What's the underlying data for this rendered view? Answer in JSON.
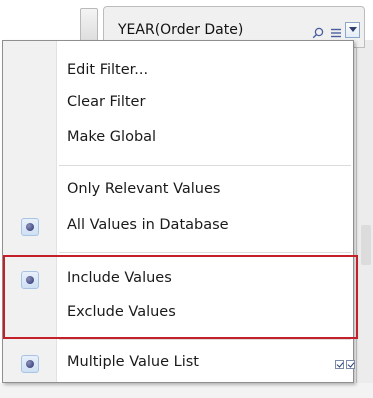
{
  "filter_card": {
    "title": "YEAR(Order Date)",
    "icons": [
      "search-icon",
      "list-icon",
      "chevron-down-icon"
    ]
  },
  "menu": {
    "items": [
      {
        "label": "Edit Filter...",
        "selected": false
      },
      {
        "label": "Clear Filter",
        "selected": false
      },
      {
        "label": "Make Global",
        "selected": false
      },
      {
        "label": "Only Relevant Values",
        "selected": false
      },
      {
        "label": "All Values in Database",
        "selected": true
      },
      {
        "label": "Include Values",
        "selected": true
      },
      {
        "label": "Exclude Values",
        "selected": false
      },
      {
        "label": "Multiple Value List",
        "selected": true
      }
    ]
  },
  "colors": {
    "highlight_border": "#c4202a",
    "radio_dot": "#2c3070"
  }
}
